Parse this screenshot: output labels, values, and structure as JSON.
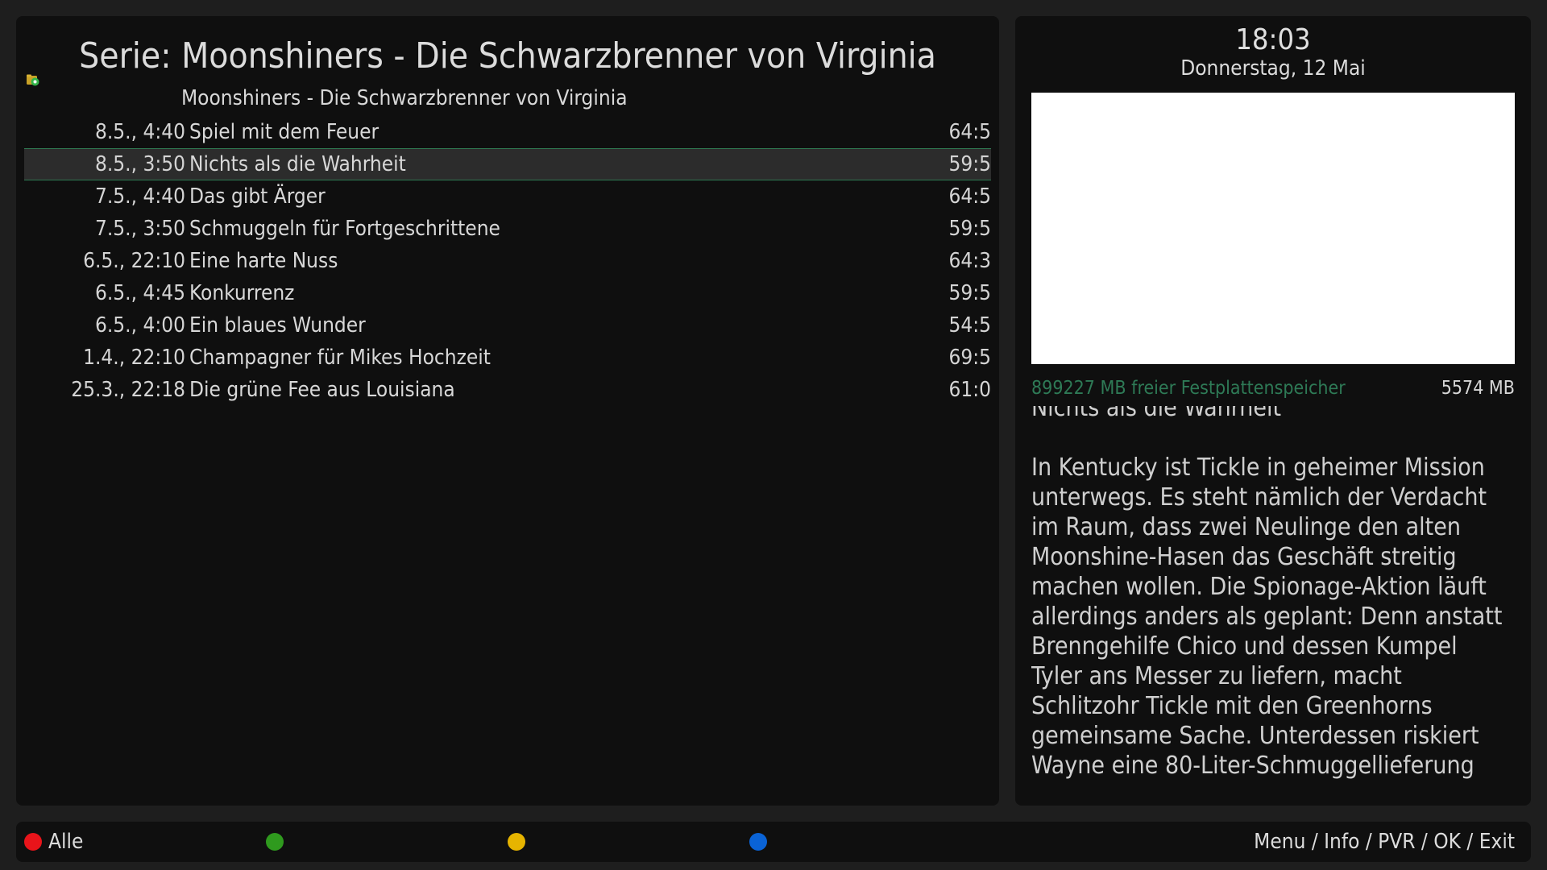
{
  "header": {
    "title": "Serie: Moonshiners - Die Schwarzbrenner von Virginia",
    "folder_name": "Moonshiners - Die Schwarzbrenner von Virginia"
  },
  "recordings": [
    {
      "date": "8.5., 4:40",
      "title": "Spiel mit dem Feuer",
      "duration": "64:5",
      "selected": false
    },
    {
      "date": "8.5., 3:50",
      "title": "Nichts als die Wahrheit",
      "duration": "59:5",
      "selected": true
    },
    {
      "date": "7.5., 4:40",
      "title": "Das gibt Ärger",
      "duration": "64:5",
      "selected": false
    },
    {
      "date": "7.5., 3:50",
      "title": "Schmuggeln für Fortgeschrittene",
      "duration": "59:5",
      "selected": false
    },
    {
      "date": "6.5., 22:10",
      "title": "Eine harte Nuss",
      "duration": "64:3",
      "selected": false
    },
    {
      "date": "6.5., 4:45",
      "title": "Konkurrenz",
      "duration": "59:5",
      "selected": false
    },
    {
      "date": "6.5., 4:00",
      "title": "Ein blaues Wunder",
      "duration": "54:5",
      "selected": false
    },
    {
      "date": "1.4., 22:10",
      "title": "Champagner für Mikes Hochzeit",
      "duration": "69:5",
      "selected": false
    },
    {
      "date": "25.3., 22:18",
      "title": "Die grüne Fee aus Louisiana",
      "duration": "61:0",
      "selected": false
    }
  ],
  "clock": {
    "time": "18:03",
    "date": "Donnerstag, 12 Mai"
  },
  "disk": {
    "free": "899227 MB freier Festplattenspeicher",
    "recording_size": "5574 MB"
  },
  "description": {
    "title": "Nichts als die Wahrheit",
    "body": "In Kentucky ist Tickle in geheimer Mission unterwegs. Es steht nämlich der Verdacht im Raum, dass zwei Neulinge den alten Moonshine-Hasen das Geschäft streitig machen wollen. Die Spionage-Aktion läuft allerdings anders als geplant: Denn anstatt Brenngehilfe Chico und dessen Kumpel Tyler ans Messer zu liefern, macht Schlitzohr Tickle mit den Greenhorns gemeinsame Sache. Unterdessen riskiert Wayne eine 80-Liter-Schmuggellieferung"
  },
  "footer": {
    "red_label": "Alle",
    "green_label": "",
    "yellow_label": "",
    "blue_label": "",
    "nav_hint": "Menu / Info / PVR / OK / Exit"
  },
  "colors": {
    "red": "#e8141a",
    "green": "#2f9a1e",
    "yellow": "#e6b400",
    "blue": "#0a63d6",
    "disk_text": "#2e7a56",
    "selection_border": "#2f7a52"
  },
  "icons": {
    "folder": "new-recordings-folder-icon"
  }
}
